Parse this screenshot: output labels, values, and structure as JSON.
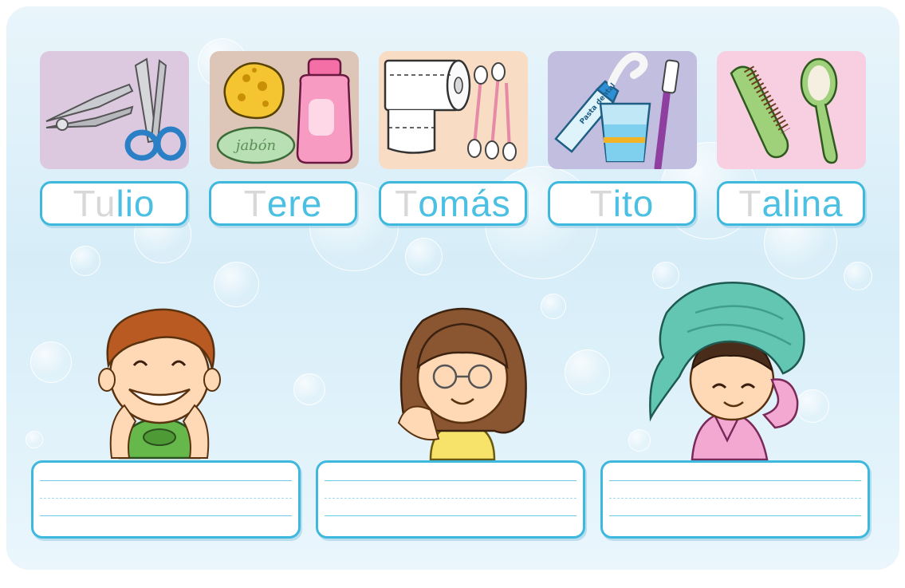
{
  "cards": [
    {
      "id": "nail-care",
      "bg": "#dcc9e0",
      "items": [
        "nail-clipper-icon",
        "scissors-icon"
      ]
    },
    {
      "id": "bath",
      "bg": "#ddc6b8",
      "items": [
        "sponge-icon",
        "soap-icon",
        "shampoo-bottle-icon"
      ],
      "soap_label": "jabón"
    },
    {
      "id": "toilet",
      "bg": "#f9dcc4",
      "items": [
        "toilet-paper-icon",
        "cotton-swabs-icon"
      ]
    },
    {
      "id": "teeth",
      "bg": "#c2bedf",
      "items": [
        "toothpaste-icon",
        "glass-icon",
        "toothbrush-icon"
      ],
      "toothpaste_label": "Pasta dental"
    },
    {
      "id": "hair",
      "bg": "#f7cfe0",
      "items": [
        "comb-icon",
        "hairbrush-icon"
      ]
    }
  ],
  "names": [
    {
      "faint": "Tu",
      "dark": "lio"
    },
    {
      "faint": "T",
      "dark": "ere"
    },
    {
      "faint": "T",
      "dark": "omás"
    },
    {
      "faint": "T",
      "dark": "ito"
    },
    {
      "faint": "T",
      "dark": "alina"
    }
  ],
  "children": [
    "boy-brushing-teeth",
    "girl-combing-hair",
    "girl-with-towel"
  ],
  "colors": {
    "accent": "#3fb8dd",
    "name_faint": "#d8d8d8",
    "name_dark": "#4cc0e3",
    "panel_bg": "#e3f2fa"
  }
}
